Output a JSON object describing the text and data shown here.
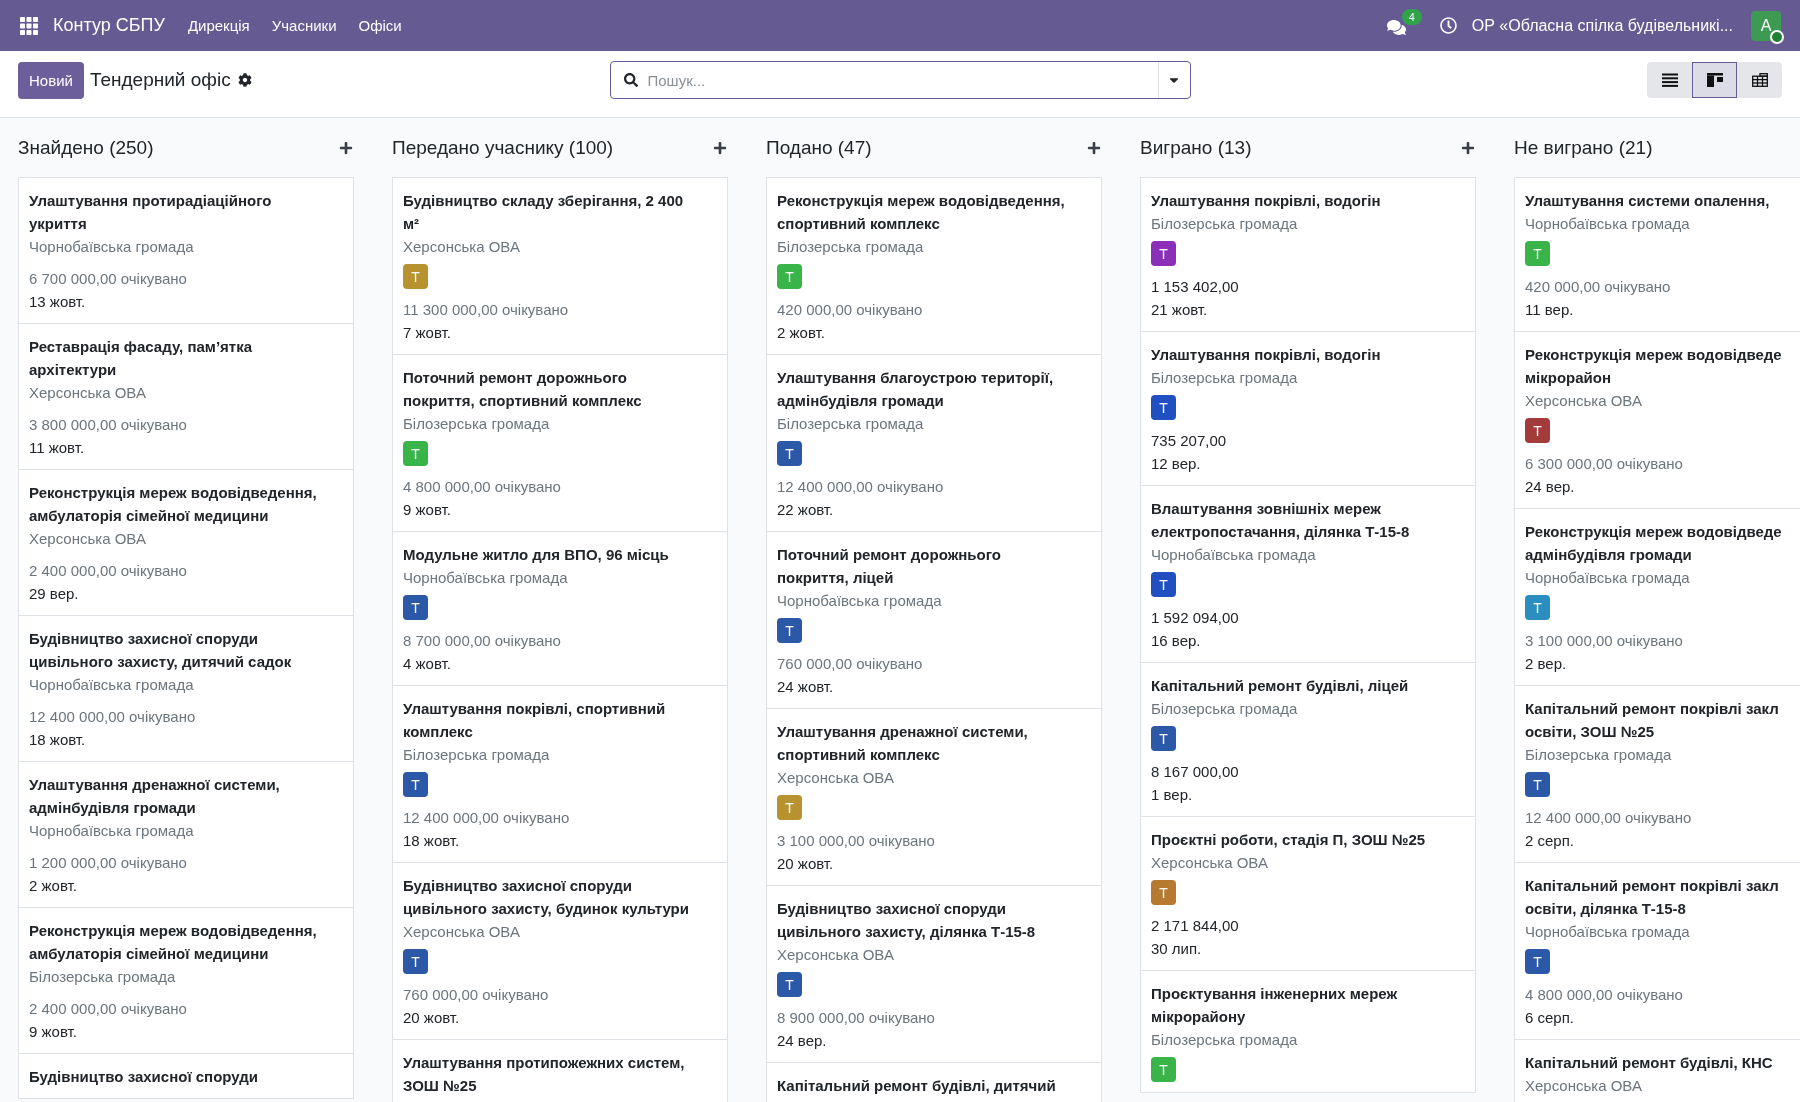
{
  "navbar": {
    "app_name": "Контур СБПУ",
    "menu": [
      "Дирекція",
      "Учасники",
      "Офіси"
    ],
    "messages_badge": "4",
    "company": "ОР «Обласна спілка будівельникі...",
    "user_initial": "A"
  },
  "control_panel": {
    "new_button": "Новий",
    "title": "Тендерний офіс",
    "search": {
      "placeholder": "Пошук..."
    },
    "views": [
      {
        "kind": "list",
        "selected": false
      },
      {
        "kind": "kanban",
        "selected": true
      },
      {
        "kind": "grid",
        "selected": false
      }
    ]
  },
  "columns": [
    {
      "title": "Знайдено (250)",
      "cards": [
        {
          "title": "Улаштування протирадіаційного\nукриття",
          "subtitle": "Чорнобаївська громада",
          "amount": "6 700 000,00 очікувано",
          "expected": true,
          "date": "13 жовт."
        },
        {
          "title": "Реставрація фасаду, пам’ятка\nархітектури",
          "subtitle": "Херсонська ОВА",
          "amount": "3 800 000,00 очікувано",
          "expected": true,
          "date": "11 жовт."
        },
        {
          "title": "Реконструкція мереж водовідведення,\nамбулаторія сімейної медицини",
          "subtitle": "Херсонська ОВА",
          "amount": "2 400 000,00 очікувано",
          "expected": true,
          "date": "29 вер."
        },
        {
          "title": "Будівництво захисної споруди\nцивільного захисту, дитячий садок",
          "subtitle": "Чорнобаївська громада",
          "amount": "12 400 000,00 очікувано",
          "expected": true,
          "date": "18 жовт."
        },
        {
          "title": "Улаштування дренажної системи,\nадмінбудівля громади",
          "subtitle": "Чорнобаївська громада",
          "amount": "1 200 000,00 очікувано",
          "expected": true,
          "date": "2 жовт."
        },
        {
          "title": "Реконструкція мереж водовідведення,\nамбулаторія сімейної медицини",
          "subtitle": "Білозерська громада",
          "amount": "2 400 000,00 очікувано",
          "expected": true,
          "date": "9 жовт."
        },
        {
          "title": "Будівництво захисної споруди"
        }
      ]
    },
    {
      "title": "Передано учаснику (100)",
      "cards": [
        {
          "title": "Будівництво складу зберігання, 2 400\nм²",
          "subtitle": "Херсонська ОВА",
          "tag": {
            "initial": "Т",
            "color": "#b8922f"
          },
          "amount": "11 300 000,00 очікувано",
          "expected": true,
          "date": "7 жовт."
        },
        {
          "title": "Поточний ремонт дорожнього\nпокриття, спортивний комплекс",
          "subtitle": "Білозерська громада",
          "tag": {
            "initial": "Т",
            "color": "#38b449"
          },
          "amount": "4 800 000,00 очікувано",
          "expected": true,
          "date": "9 жовт."
        },
        {
          "title": "Модульне житло для ВПО, 96 місць",
          "subtitle": "Чорнобаївська громада",
          "tag": {
            "initial": "Т",
            "color": "#2c58a8"
          },
          "amount": "8 700 000,00 очікувано",
          "expected": true,
          "date": "4 жовт."
        },
        {
          "title": "Улаштування покрівлі, спортивний\nкомплекс",
          "subtitle": "Білозерська громада",
          "tag": {
            "initial": "Т",
            "color": "#2c58a8"
          },
          "amount": "12 400 000,00 очікувано",
          "expected": true,
          "date": "18 жовт."
        },
        {
          "title": "Будівництво захисної споруди\nцивільного захисту, будинок культури",
          "subtitle": "Херсонська ОВА",
          "tag": {
            "initial": "Т",
            "color": "#2c58a8"
          },
          "amount": "760 000,00 очікувано",
          "expected": true,
          "date": "20 жовт."
        },
        {
          "title": "Улаштування протипожежних систем,\nЗОШ №25"
        }
      ]
    },
    {
      "title": "Подано (47)",
      "cards": [
        {
          "title": "Реконструкція мереж водовідведення,\nспортивний комплекс",
          "subtitle": "Білозерська громада",
          "tag": {
            "initial": "Т",
            "color": "#38b449"
          },
          "amount": "420 000,00 очікувано",
          "expected": true,
          "date": "2 жовт."
        },
        {
          "title": "Улаштування благоустрою території,\nадмінбудівля громади",
          "subtitle": "Білозерська громада",
          "tag": {
            "initial": "Т",
            "color": "#2c58a8"
          },
          "amount": "12 400 000,00 очікувано",
          "expected": true,
          "date": "22 жовт."
        },
        {
          "title": "Поточний ремонт дорожнього\nпокриття, ліцей",
          "subtitle": "Чорнобаївська громада",
          "tag": {
            "initial": "Т",
            "color": "#2c58a8"
          },
          "amount": "760 000,00 очікувано",
          "expected": true,
          "date": "24 жовт."
        },
        {
          "title": "Улаштування дренажної системи,\nспортивний комплекс",
          "subtitle": "Херсонська ОВА",
          "tag": {
            "initial": "Т",
            "color": "#b8922f"
          },
          "amount": "3 100 000,00 очікувано",
          "expected": true,
          "date": "20 жовт."
        },
        {
          "title": "Будівництво захисної споруди\nцивільного захисту, ділянка Т-15-8",
          "subtitle": "Херсонська ОВА",
          "tag": {
            "initial": "Т",
            "color": "#2c58a8"
          },
          "amount": "8 900 000,00 очікувано",
          "expected": true,
          "date": "24 вер."
        },
        {
          "title": "Капітальний ремонт будівлі, дитячий"
        }
      ]
    },
    {
      "title": "Виграно (13)",
      "cards": [
        {
          "title": "Улаштування покрівлі, водогін",
          "subtitle": "Білозерська громада",
          "tag": {
            "initial": "Т",
            "color": "#8b2fb9"
          },
          "amount": "1 153 402,00",
          "expected": false,
          "date": "21 жовт."
        },
        {
          "title": "Улаштування покрівлі, водогін",
          "subtitle": "Білозерська громада",
          "tag": {
            "initial": "Т",
            "color": "#1f4fc0"
          },
          "amount": "735 207,00",
          "expected": false,
          "date": "12 вер."
        },
        {
          "title": "Влаштування зовнішніх мереж\nелектропостачання, ділянка Т-15-8",
          "subtitle": "Чорнобаївська громада",
          "tag": {
            "initial": "Т",
            "color": "#1f4fc0"
          },
          "amount": "1 592 094,00",
          "expected": false,
          "date": "16 вер."
        },
        {
          "title": "Капітальний ремонт будівлі, ліцей",
          "subtitle": "Білозерська громада",
          "tag": {
            "initial": "Т",
            "color": "#2c58a8"
          },
          "amount": "8 167 000,00",
          "expected": false,
          "date": "1 вер."
        },
        {
          "title": "Проєктні роботи, стадія П, ЗОШ №25",
          "subtitle": "Херсонська ОВА",
          "tag": {
            "initial": "Т",
            "color": "#b57a30"
          },
          "amount": "2 171 844,00",
          "expected": false,
          "date": "30 лип."
        },
        {
          "title": "Проєктування інженерних мереж\nмікрорайону",
          "subtitle": "Білозерська громада",
          "tag": {
            "initial": "Т",
            "color": "#38b449"
          }
        }
      ]
    },
    {
      "title": "Не виграно (21)",
      "cards": [
        {
          "title": "Улаштування системи опалення,",
          "subtitle": "Чорнобаївська громада",
          "tag": {
            "initial": "Т",
            "color": "#38b449"
          },
          "amount": "420 000,00 очікувано",
          "expected": true,
          "date": "11 вер."
        },
        {
          "title": "Реконструкція мереж водовідведе\nмікрорайон",
          "subtitle": "Херсонська ОВА",
          "tag": {
            "initial": "Т",
            "color": "#a43b3b"
          },
          "amount": "6 300 000,00 очікувано",
          "expected": true,
          "date": "24 вер."
        },
        {
          "title": "Реконструкція мереж водовідведе\nадмінбудівля громади",
          "subtitle": "Чорнобаївська громада",
          "tag": {
            "initial": "Т",
            "color": "#2b8ec0"
          },
          "amount": "3 100 000,00 очікувано",
          "expected": true,
          "date": "2 вер."
        },
        {
          "title": "Капітальний ремонт покрівлі закл\nосвіти, ЗОШ №25",
          "subtitle": "Білозерська громада",
          "tag": {
            "initial": "Т",
            "color": "#2c58a8"
          },
          "amount": "12 400 000,00 очікувано",
          "expected": true,
          "date": "2 серп."
        },
        {
          "title": "Капітальний ремонт покрівлі закл\nосвіти, ділянка Т-15-8",
          "subtitle": "Чорнобаївська громада",
          "tag": {
            "initial": "Т",
            "color": "#2c58a8"
          },
          "amount": "4 800 000,00 очікувано",
          "expected": true,
          "date": "6 серп."
        },
        {
          "title": "Капітальний ремонт будівлі, КНС",
          "subtitle": "Херсонська ОВА"
        }
      ]
    }
  ]
}
